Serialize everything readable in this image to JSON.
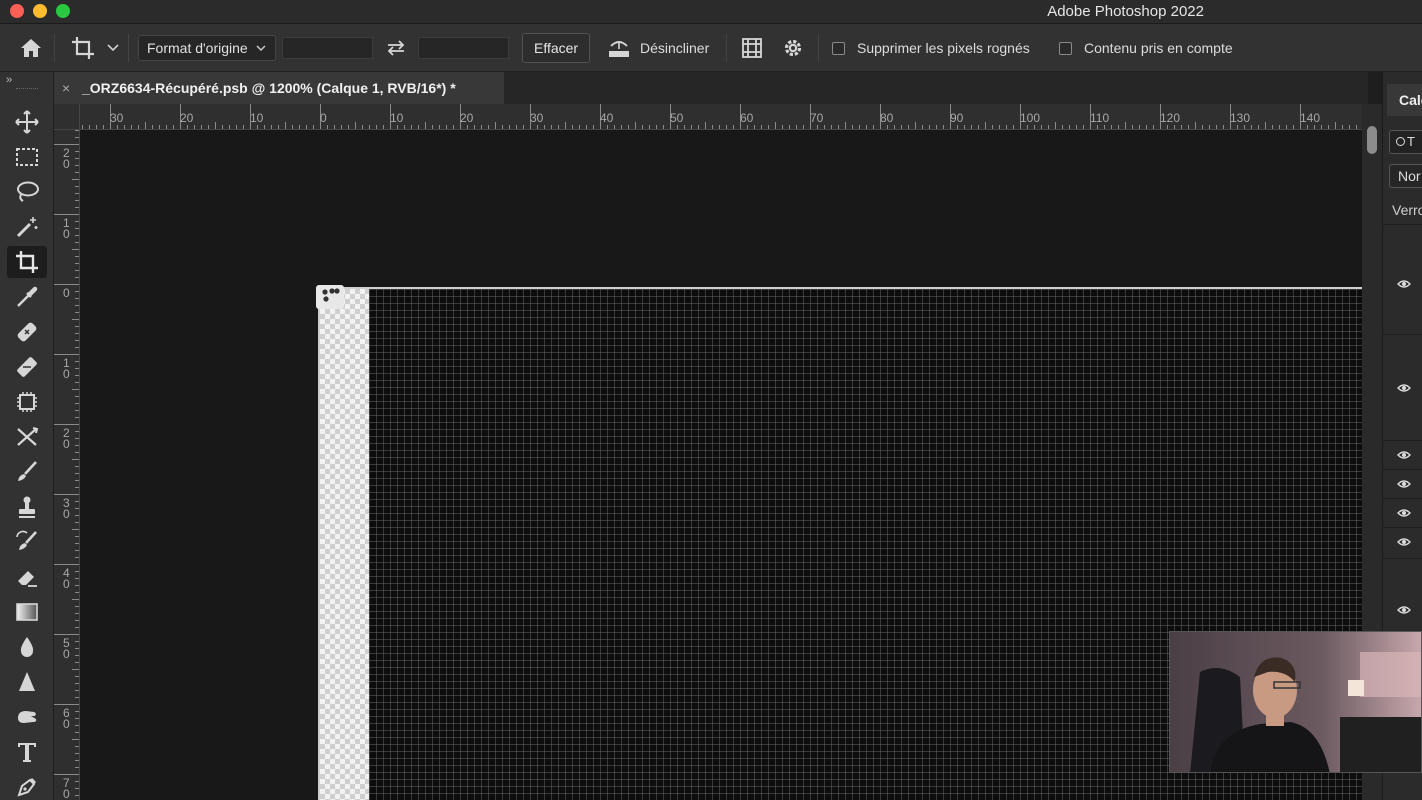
{
  "window": {
    "app_title": "Adobe Photoshop 2022"
  },
  "options_bar": {
    "ratio_select": "Format d'origine",
    "width_value": "",
    "height_value": "",
    "clear_button": "Effacer",
    "straighten_button": "Désincliner",
    "delete_cropped_label": "Supprimer les pixels rognés",
    "delete_cropped_checked": false,
    "content_aware_label": "Contenu pris en compte",
    "content_aware_checked": false
  },
  "document_tab": {
    "title": "_ORZ6634-Récupéré.psb @ 1200% (Calque 1, RVB/16*) *",
    "close_glyph": "×"
  },
  "ruler_top_labels": [
    "30",
    "20",
    "10",
    "0",
    "10",
    "20",
    "30",
    "40",
    "50",
    "60",
    "70",
    "80",
    "90",
    "100",
    "110",
    "120",
    "130",
    "140"
  ],
  "ruler_left_labels": [
    "20",
    "10",
    "0",
    "10",
    "20",
    "30",
    "40",
    "50",
    "60",
    "70"
  ],
  "toolbar": {
    "collapse_glyph": "››",
    "tools": [
      "move-icon",
      "marquee-icon",
      "lasso-icon",
      "magic-wand-icon",
      "crop-icon",
      "eyedropper-icon",
      "spot-healing-icon",
      "healing-patch-icon",
      "content-aware-move-icon",
      "puppet-warp-icon",
      "brush-icon",
      "clone-stamp-icon",
      "history-brush-icon",
      "eraser-icon",
      "gradient-icon",
      "blur-icon",
      "sharpen-icon",
      "smudge-icon",
      "type-icon",
      "pen-icon"
    ],
    "active_tool": "crop-icon"
  },
  "layers_panel": {
    "tab_label": "Calc",
    "search_text": "T",
    "blend_mode": "Nor",
    "lock_label": "Verro",
    "visible_rows": 7
  },
  "colors": {
    "app_bg": "#323232",
    "canvas_bg": "#181818",
    "traffic_red": "#fe5f57",
    "traffic_yellow": "#febc2e",
    "traffic_green": "#28c840"
  }
}
